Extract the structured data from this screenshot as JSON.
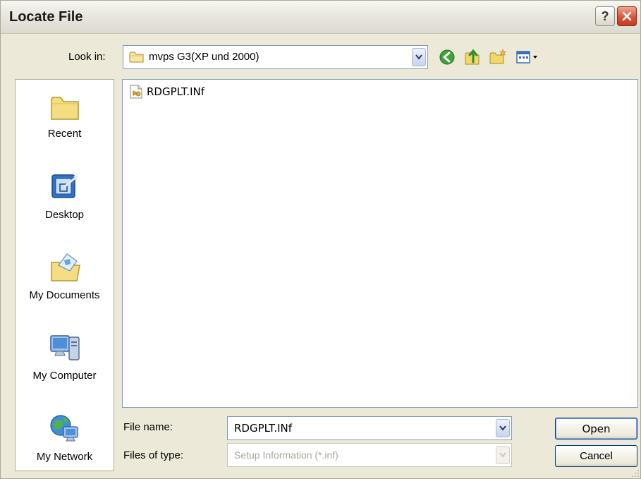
{
  "window": {
    "title": "Locate File"
  },
  "toolbar": {
    "look_in_label": "Look in:",
    "look_in_value": "mvps G3(XP und 2000)",
    "icons": [
      "back-icon",
      "up-folder-icon",
      "new-folder-icon",
      "view-menu-icon"
    ]
  },
  "places": [
    {
      "label": "Recent",
      "icon": "recent-folder-icon"
    },
    {
      "label": "Desktop",
      "icon": "desktop-icon"
    },
    {
      "label": "My Documents",
      "icon": "my-documents-icon"
    },
    {
      "label": "My Computer",
      "icon": "my-computer-icon"
    },
    {
      "label": "My Network",
      "icon": "my-network-icon"
    }
  ],
  "files": [
    {
      "name": "RDGPLT.INf",
      "icon": "setup-file-icon"
    }
  ],
  "form": {
    "file_name_label": "File name:",
    "file_name_value": "RDGPLT.INf",
    "file_type_label": "Files of type:",
    "file_type_value": "Setup Information (*.inf)"
  },
  "buttons": {
    "open": "Open",
    "cancel": "Cancel",
    "help": "?"
  },
  "colors": {
    "dialog_bg": "#ece9d8",
    "close_button": "#d9533a",
    "field_border": "#7f9db9"
  }
}
